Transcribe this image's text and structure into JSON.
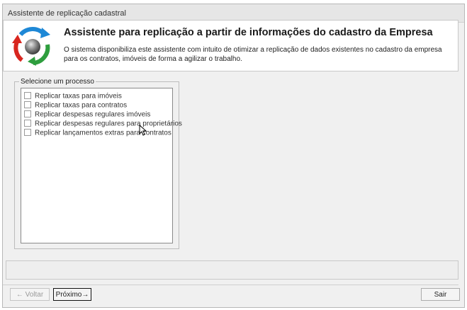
{
  "window": {
    "title": "Assistente de replicação cadastral"
  },
  "header": {
    "title": "Assistente para replicação a partir de informações do cadastro da Empresa",
    "description": "O sistema disponibiliza este assistente com intuito de otimizar a replicação de dados existentes no cadastro da empresa para os contratos, imóveis de forma a agilizar o trabalho."
  },
  "process_group": {
    "legend": "Selecione um processo",
    "items": [
      {
        "label": "Replicar taxas para imóveis",
        "checked": false
      },
      {
        "label": "Replicar taxas para contratos",
        "checked": false
      },
      {
        "label": "Replicar despesas regulares imóveis",
        "checked": false
      },
      {
        "label": "Replicar despesas regulares para proprietários",
        "checked": false
      },
      {
        "label": "Replicar lançamentos extras para contratos",
        "checked": false
      }
    ]
  },
  "buttons": {
    "back": "← Voltar",
    "next": "Próximo→",
    "exit": "Sair"
  },
  "colors": {
    "logo_red": "#d8261f",
    "logo_blue": "#1e88d6",
    "logo_green": "#2e9e3e",
    "logo_sphere": "#6b6b6b"
  }
}
